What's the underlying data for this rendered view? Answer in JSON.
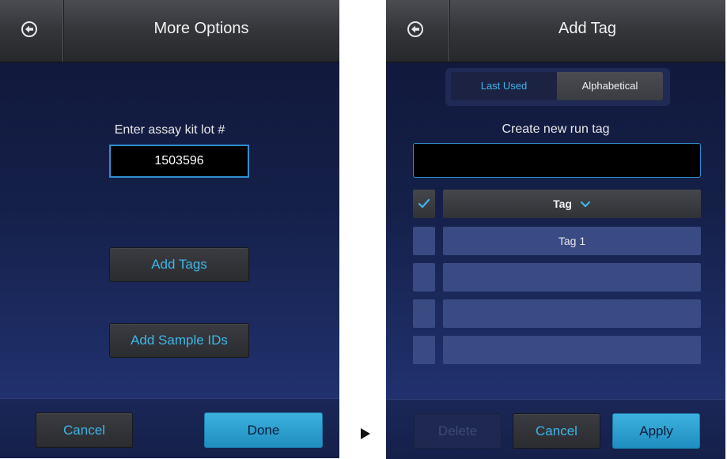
{
  "left_screen": {
    "title": "More Options",
    "lot_label": "Enter assay kit lot #",
    "lot_value": "1503596",
    "add_tags_label": "Add Tags",
    "add_sample_ids_label": "Add Sample IDs",
    "cancel_label": "Cancel",
    "done_label": "Done"
  },
  "right_screen": {
    "title": "Add Tag",
    "segments": [
      "Last Used",
      "Alphabetical"
    ],
    "selected_segment": "Last Used",
    "create_label": "Create new run tag",
    "new_tag_value": "",
    "column_header": "Tag",
    "rows": [
      {
        "label": "Tag 1",
        "checked": false
      },
      {
        "label": "",
        "checked": false
      },
      {
        "label": "",
        "checked": false
      },
      {
        "label": "",
        "checked": false
      }
    ],
    "header_checked": true,
    "delete_label": "Delete",
    "cancel_label": "Cancel",
    "apply_label": "Apply"
  },
  "colors": {
    "accent": "#3eb6e8",
    "primary_button": "#2aa0d2",
    "background": "#152049"
  },
  "icons": {
    "back": "back-arrow-circle-icon",
    "flow_arrow": "right-triangle-arrow-icon",
    "check": "checkmark-icon",
    "sort": "chevron-down-icon"
  }
}
